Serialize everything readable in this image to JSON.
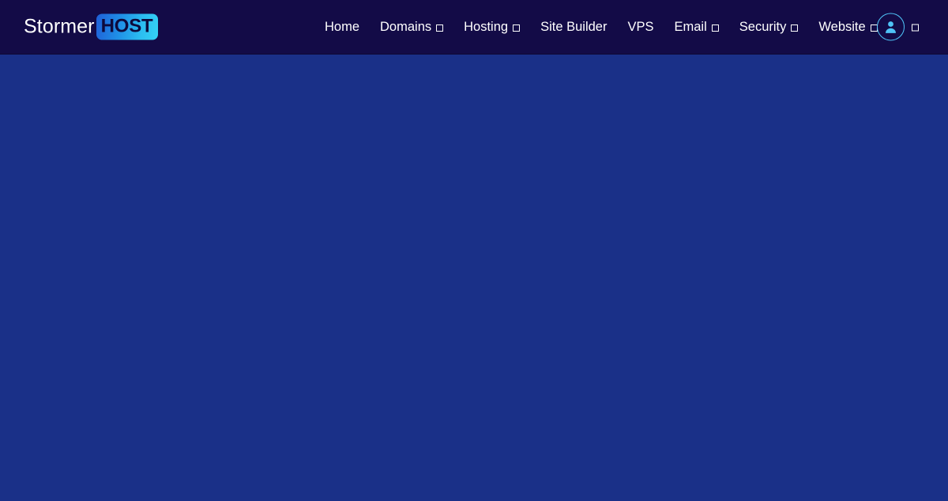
{
  "colors": {
    "header_bg": "#130b47",
    "body_bg": "#1a3088",
    "nav_text": "#ffffff",
    "accent_cyan": "#35d3f5",
    "accent_blue": "#1f5fd8",
    "logo_badge_text": "#0d0a3c",
    "avatar_ring": "#4fc3f7"
  },
  "header": {
    "logo": {
      "name": "StormerHOST",
      "text_primary": "Stormer",
      "text_badge": "HOST"
    },
    "nav": {
      "items": [
        {
          "label": "Home",
          "has_dropdown": false,
          "dropdown_glyph": ""
        },
        {
          "label": "Domains",
          "has_dropdown": true,
          "dropdown_glyph": "□"
        },
        {
          "label": "Hosting",
          "has_dropdown": true,
          "dropdown_glyph": "□"
        },
        {
          "label": "Site Builder",
          "has_dropdown": false,
          "dropdown_glyph": ""
        },
        {
          "label": "VPS",
          "has_dropdown": false,
          "dropdown_glyph": ""
        },
        {
          "label": "Email",
          "has_dropdown": true,
          "dropdown_glyph": "□"
        },
        {
          "label": "Security",
          "has_dropdown": true,
          "dropdown_glyph": "□"
        },
        {
          "label": "Website",
          "has_dropdown": true,
          "dropdown_glyph": "□"
        }
      ]
    },
    "account": {
      "icon": "user-avatar-icon",
      "dropdown_glyph": "□"
    }
  },
  "main": {
    "content": ""
  }
}
